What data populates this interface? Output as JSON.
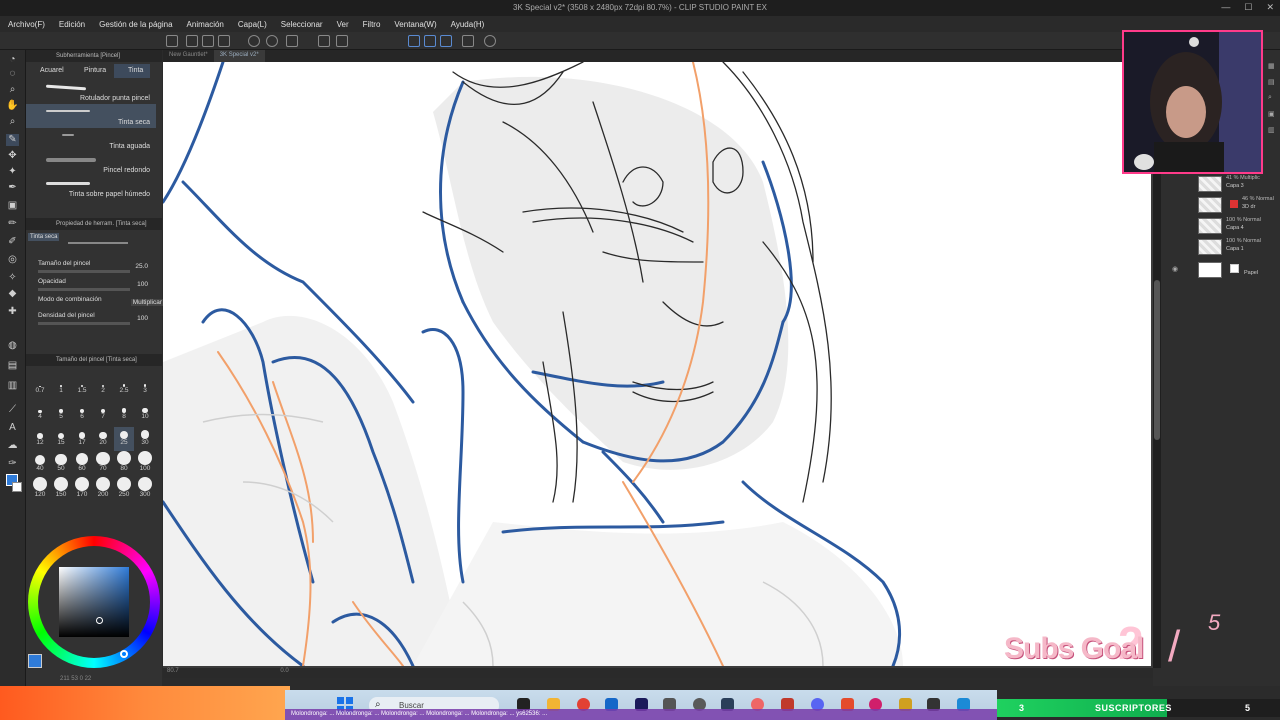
{
  "window": {
    "title": "3K Special v2* (3508 x 2480px 72dpi 80.7%) - CLIP STUDIO PAINT EX"
  },
  "menu": [
    "Archivo(F)",
    "Edición",
    "Gestión de la página",
    "Animación",
    "Capa(L)",
    "Seleccionar",
    "Ver",
    "Filtro",
    "Ventana(W)",
    "Ayuda(H)"
  ],
  "subtool_panel": {
    "header": "Subherramienta [Pincel]",
    "tabs": [
      "Acuarel",
      "Pintura",
      "Tinta"
    ],
    "active_tab": "Tinta",
    "brushes": [
      "Rotulador punta pincel",
      "Tinta seca",
      "Tinta aguada",
      "Pincel redondo",
      "Tinta sobre papel húmedo"
    ],
    "active_brush": "Tinta seca"
  },
  "tool_property": {
    "header": "Propiedad de herram. [Tinta seca]",
    "preview_label": "Tinta seca",
    "props": [
      {
        "label": "Tamaño del pincel",
        "value": "25.0"
      },
      {
        "label": "Opacidad",
        "value": "100"
      },
      {
        "label": "Modo de combinación",
        "value": "Multiplicar"
      },
      {
        "label": "Densidad del pincel",
        "value": "100"
      }
    ]
  },
  "brush_size": {
    "header": "Tamaño del pincel [Tinta seca]",
    "sizes": [
      "0.7",
      "1",
      "1.5",
      "2",
      "2.5",
      "3",
      "4",
      "5",
      "6",
      "7",
      "8",
      "10",
      "12",
      "15",
      "17",
      "20",
      "25",
      "30",
      "40",
      "50",
      "60",
      "70",
      "80",
      "100",
      "120",
      "150",
      "170",
      "200",
      "250",
      "300"
    ],
    "selected": "25"
  },
  "color": {
    "main": "#2f7bd8"
  },
  "doc_tabs": [
    "New Gauntlet*",
    "3K Special v2*"
  ],
  "active_doc": "3K Special v2*",
  "status": {
    "zoom": "80.7",
    "angle": "0.0",
    "coords": "211  53  0  22"
  },
  "layers": [
    {
      "mode": "41 % Multiplic",
      "name": "Capa 3"
    },
    {
      "mode": "46 % Normal",
      "name": "3D dr"
    },
    {
      "mode": "100 % Normal",
      "name": "Capa 4"
    },
    {
      "mode": "100 % Normal",
      "name": "Capa 1"
    },
    {
      "mode": "",
      "name": "Papel"
    }
  ],
  "subs_goal": {
    "label": "Subs Goal",
    "current_big": "2",
    "target": "5"
  },
  "progress": {
    "left": "3",
    "label": "SUSCRIPTORES",
    "right": "5",
    "fraction": 0.6
  },
  "taskbar": {
    "search_placeholder": "Buscar"
  },
  "ticker": "Molondronga: ...   Molondronga: ...   Molondronga: ...   Molondronga: ...   Molondronga: ...   ys62536: ...",
  "accent": "#ff3b8a"
}
